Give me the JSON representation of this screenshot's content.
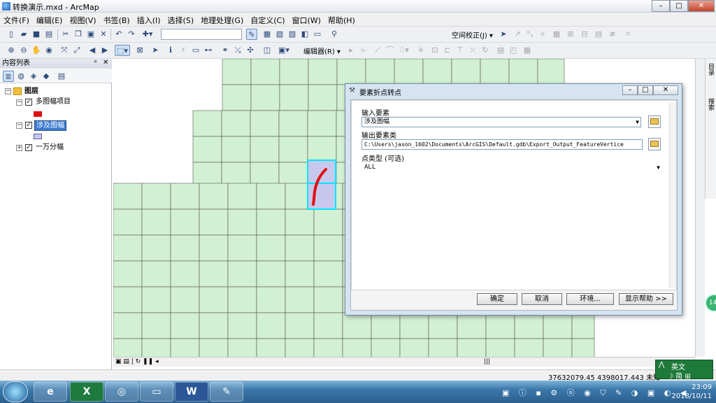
{
  "window": {
    "title": "转换演示.mxd - ArcMap",
    "min": "–",
    "max": "□",
    "close": "✕"
  },
  "menu": [
    "文件(F)",
    "编辑(E)",
    "视图(V)",
    "书签(B)",
    "插入(I)",
    "选择(S)",
    "地理处理(G)",
    "自定义(C)",
    "窗口(W)",
    "帮助(H)"
  ],
  "toolbar": {
    "spatial_adjust": "空间校正(J) ▾",
    "editor": "编辑器(R) ▾"
  },
  "toc": {
    "title": "内容列表",
    "pin": "ᵖ",
    "close": "✕",
    "root": "图层",
    "layers": [
      {
        "name": "多图幅项目",
        "checked": "✓",
        "color": "#e01010"
      },
      {
        "name": "涉及图幅",
        "checked": "✓",
        "color": "#c8c8ee",
        "selected": true
      },
      {
        "name": "一万分幅",
        "checked": "✓"
      }
    ]
  },
  "right_dock": {
    "tab1": "目录",
    "tab2": "搜索"
  },
  "dialog": {
    "title": "要素折点转点",
    "input_label": "输入要素",
    "input_value": "涉及图幅",
    "output_label": "输出要素类",
    "output_value": "C:\\Users\\jason_1602\\Documents\\ArcGIS\\Default.gdb\\Export_Output_FeatureVertice",
    "point_type_label": "点类型 (可选)",
    "point_type_value": "ALL",
    "btn_ok": "确定",
    "btn_cancel": "取消",
    "btn_env": "环境...",
    "btn_help": "显示帮助 >>"
  },
  "status": {
    "coords": "37632079.45  4398017.443 未知"
  },
  "ime": {
    "lang": "英文",
    "tools": "☽ 简 ⊞"
  },
  "taskbar": {
    "time": "23:09",
    "date": "2018/10/11"
  },
  "side_badge": "14",
  "map": {
    "fill": "#d2f0d2",
    "line": "#555555",
    "highlight": "#00e5ff",
    "feature": "#e01010",
    "selected_fill": "#c8c8ee"
  }
}
